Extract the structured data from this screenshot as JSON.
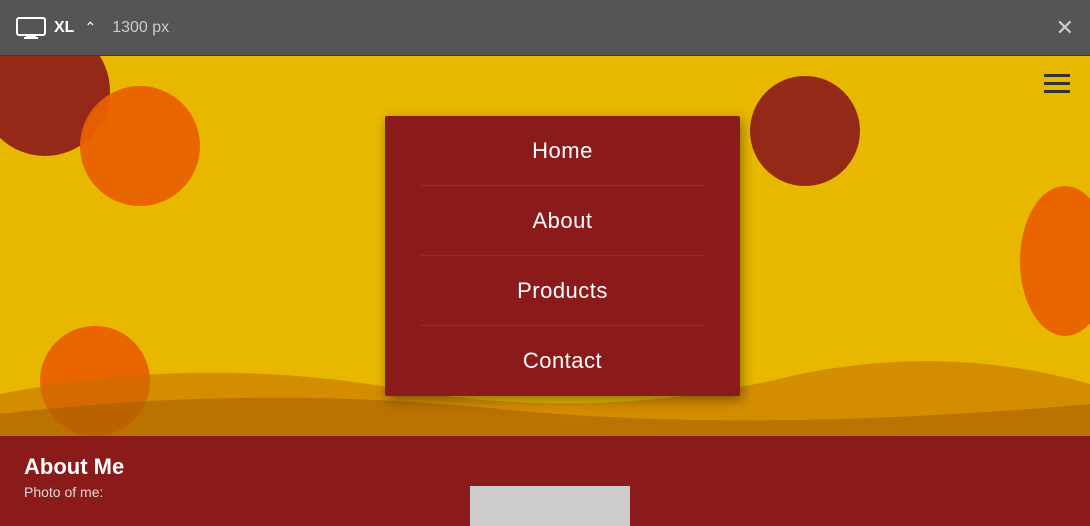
{
  "toolbar": {
    "breakpoint": "XL",
    "width_label": "1300 px",
    "close_label": "✕"
  },
  "menu": {
    "items": [
      {
        "label": "Home",
        "id": "home"
      },
      {
        "label": "About",
        "id": "about"
      },
      {
        "label": "Products",
        "id": "products"
      },
      {
        "label": "Contact",
        "id": "contact"
      }
    ]
  },
  "about_section": {
    "title": "About Me",
    "subtitle": "Photo of me:"
  },
  "colors": {
    "background_yellow": "#E8B800",
    "menu_bg": "#8B1A1A",
    "bottom_bg": "#8B1A1A",
    "circle_dark_red": "#8B1A1A",
    "circle_orange": "#E85A00",
    "circle_orange2": "#E86400"
  }
}
